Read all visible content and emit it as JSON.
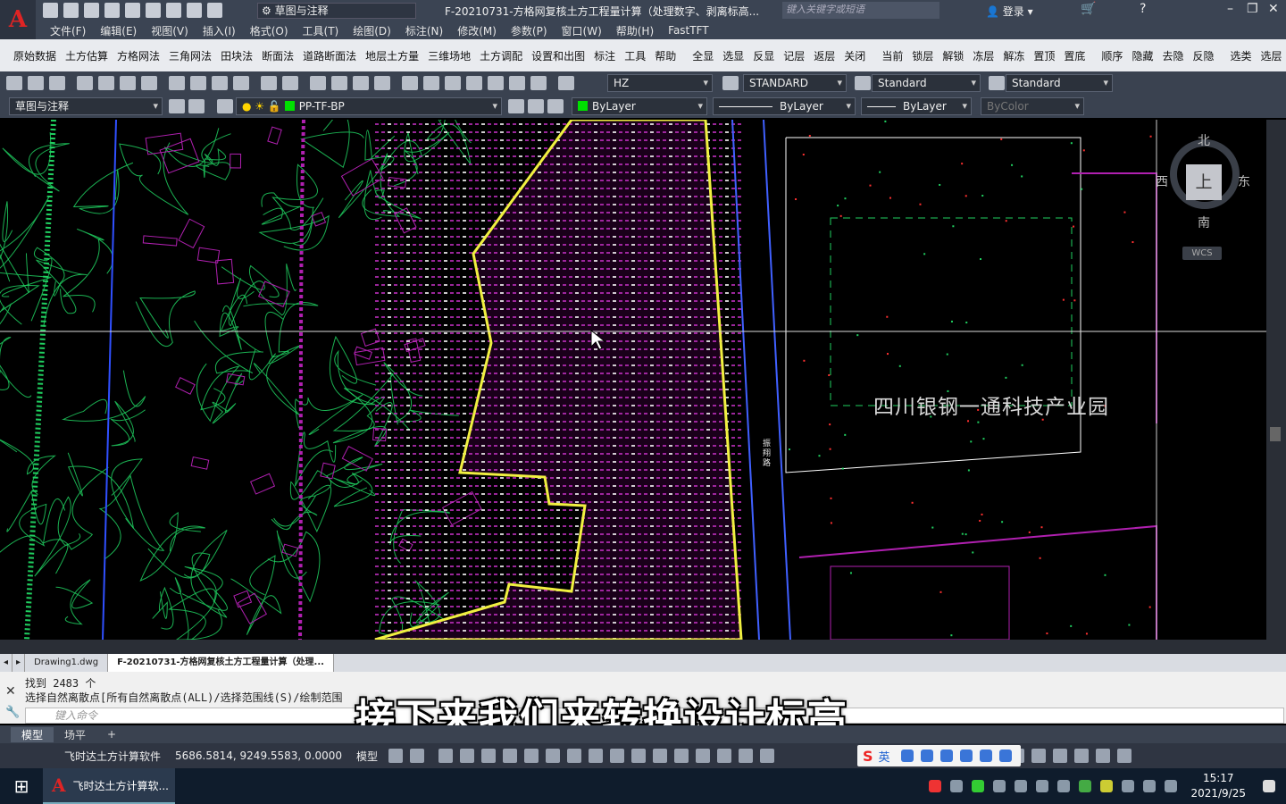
{
  "titlebar": {
    "workspace": "草图与注释",
    "doc_title": "F-20210731-方格网复核土方工程量计算（处理数字、剥离标高...",
    "search_placeholder": "键入关键字或短语",
    "login": "登录"
  },
  "menu": [
    "文件(F)",
    "编辑(E)",
    "视图(V)",
    "插入(I)",
    "格式(O)",
    "工具(T)",
    "绘图(D)",
    "标注(N)",
    "修改(M)",
    "参数(P)",
    "窗口(W)",
    "帮助(H)",
    "FastTFT"
  ],
  "plugin_menu_left": [
    "原始数据",
    "土方估算",
    "方格网法",
    "三角网法",
    "田块法",
    "断面法",
    "道路断面法",
    "地层土方量",
    "三维场地",
    "土方调配",
    "设置和出图",
    "标注",
    "工具",
    "帮助"
  ],
  "plugin_menu_right": [
    "全显",
    "选显",
    "反显",
    "记层",
    "返层",
    "关闭",
    "当前",
    "锁层",
    "解锁",
    "冻层",
    "解冻",
    "置顶",
    "置底",
    "顺序",
    "隐藏",
    "去隐",
    "反隐",
    "选类",
    "选层",
    "反选"
  ],
  "toolbar": {
    "text_style": "HZ",
    "dim_style": "STANDARD",
    "table_style": "Standard",
    "multileader_style": "Standard",
    "workspace2": "草图与注释",
    "layer": "PP-TF-BP",
    "color": "ByLayer",
    "linetype": "ByLayer",
    "lineweight": "ByLayer",
    "plotstyle": "ByColor"
  },
  "drawing": {
    "park_label": "四川银钢一通科技产业园",
    "road_label": "振翔路",
    "compass": {
      "north": "北",
      "south": "南",
      "east": "东",
      "west": "西",
      "top": "上",
      "wcs": "WCS"
    }
  },
  "doc_tabs": [
    "Drawing1.dwg",
    "F-20210731-方格网复核土方工程量计算（处理..."
  ],
  "command": {
    "history1": "找到 2483 个",
    "history2": "选择自然离散点[所有自然离散点(ALL)/选择范围线(S)/绘制范围",
    "placeholder": "键入命令"
  },
  "subtitle": "接下来我们来转换设计标高",
  "layout_tabs": [
    "模型",
    "场平"
  ],
  "status": {
    "app_name": "飞时达土方计算软件",
    "coords": "5686.5814, 9249.5583, 0.0000",
    "mode": "模型"
  },
  "ime": {
    "lang": "英"
  },
  "taskbar": {
    "app": "飞时达土方计算软...",
    "time": "15:17",
    "date": "2021/9/25"
  },
  "colors": {
    "grid_magenta": "#c030c0",
    "boundary_yellow": "#f0f040",
    "contour_green": "#20d060",
    "building_magenta": "#b020b0"
  }
}
